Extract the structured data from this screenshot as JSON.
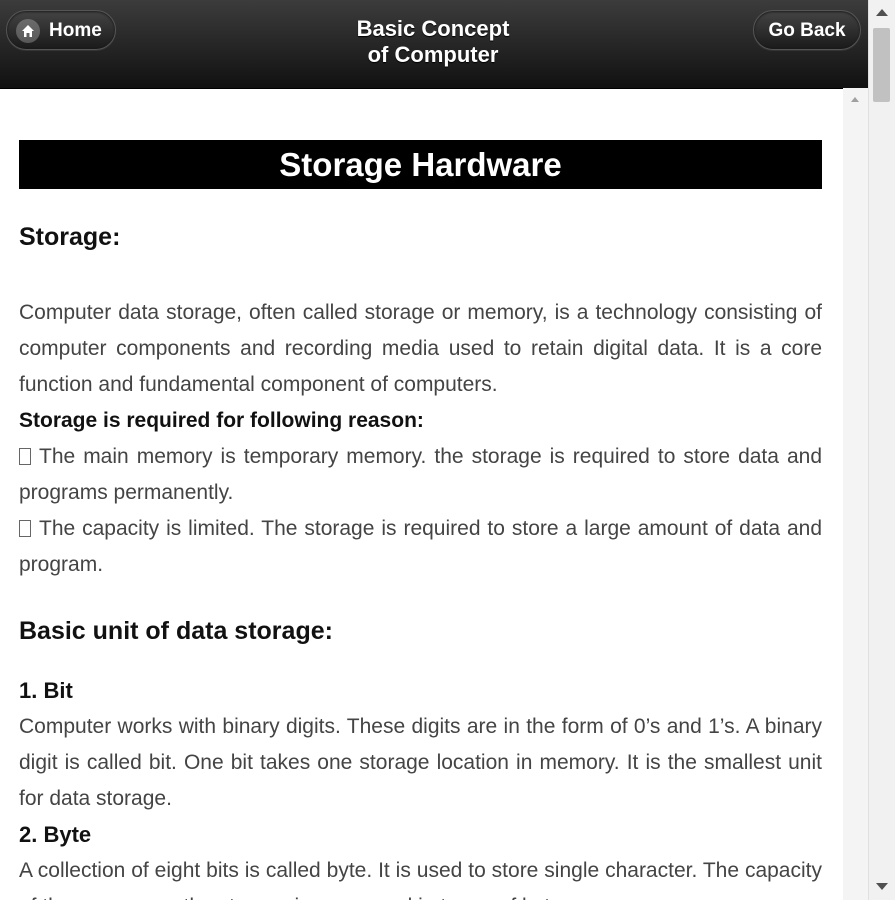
{
  "header": {
    "home_label": "Home",
    "title_line1": "Basic Concept",
    "title_line2": "of Computer",
    "back_label": "Go Back"
  },
  "icons": {
    "home": "home-icon",
    "scroll_up": "up-arrow-icon",
    "scroll_down": "down-arrow-icon"
  },
  "content": {
    "page_title": "Storage Hardware",
    "storage_heading": "Storage:",
    "storage_paragraph": "Computer data storage, often called storage or memory, is a technology consisting of computer components and recording media used to retain digital data. It is a core function and fundamental component of computers.",
    "reason_heading": "Storage is required for following reason:",
    "reasons": [
      "The main memory is temporary memory. the storage is required to store data and programs permanently.",
      "The capacity is limited. The storage is required to store a large amount of data and program."
    ],
    "basic_unit_heading": "Basic unit of data storage:",
    "units": [
      {
        "title": "1. Bit",
        "text": "Computer works with binary digits. These digits are in the form of 0’s and 1’s. A binary digit is called bit. One bit takes one storage location in memory. It is the smallest unit for data storage."
      },
      {
        "title": "2. Byte",
        "text": "A collection of eight bits is called byte. It is used to store single character. The capacity of the memory or the storage is expressed in terms of bytes."
      }
    ]
  },
  "colors": {
    "header_bg": "#1a1a1a",
    "title_bar_bg": "#000000",
    "body_text": "#444444",
    "heading_text": "#111111"
  }
}
